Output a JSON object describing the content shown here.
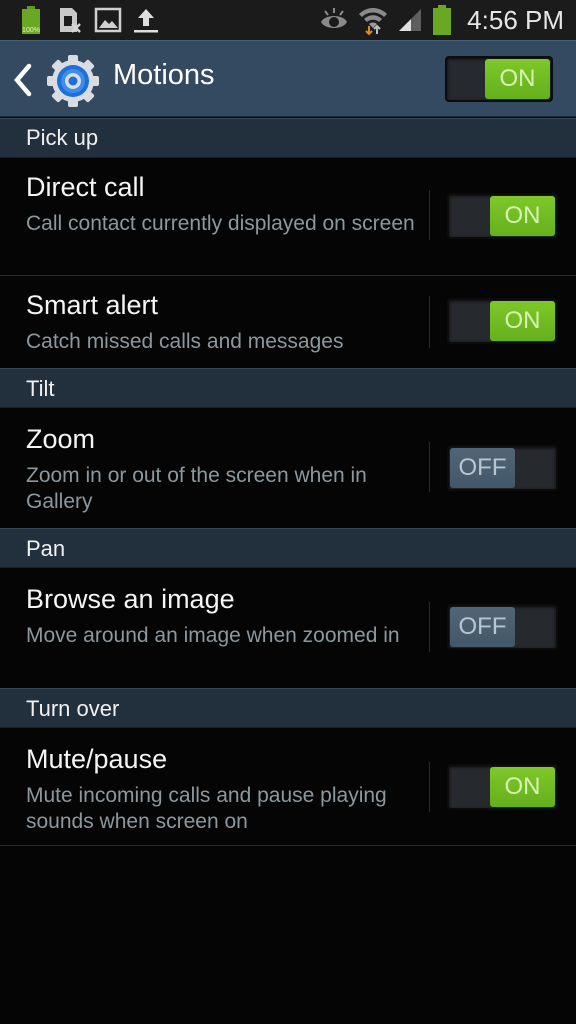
{
  "status_bar": {
    "battery_label": "100%",
    "time": "4:56 PM",
    "left_icons": [
      "battery-full-icon",
      "sim-missing-icon",
      "gallery-image-icon",
      "upload-icon"
    ],
    "right_icons": [
      "smart-stay-eye-icon",
      "wifi-data-icon",
      "cellular-signal-icon",
      "battery-icon"
    ]
  },
  "action_bar": {
    "title": "Motions",
    "master_switch": {
      "state": "on",
      "label": "ON"
    }
  },
  "sections": [
    {
      "header": "Pick up",
      "items": [
        {
          "title": "Direct call",
          "subtitle": "Call contact currently displayed on screen",
          "state": "on",
          "label": "ON"
        },
        {
          "title": "Smart alert",
          "subtitle": "Catch missed calls and messages",
          "state": "on",
          "label": "ON"
        }
      ]
    },
    {
      "header": "Tilt",
      "items": [
        {
          "title": "Zoom",
          "subtitle": "Zoom in or out of the screen when in Gallery",
          "state": "off",
          "label": "OFF"
        }
      ]
    },
    {
      "header": "Pan",
      "items": [
        {
          "title": "Browse an image",
          "subtitle": "Move around an image when zoomed in",
          "state": "off",
          "label": "OFF"
        }
      ]
    },
    {
      "header": "Turn over",
      "items": [
        {
          "title": "Mute/pause",
          "subtitle": "Mute incoming calls and pause playing sounds when screen on",
          "state": "on",
          "label": "ON"
        }
      ]
    }
  ],
  "colors": {
    "action_bar": "#334a60",
    "section_header": "#22303d",
    "switch_on": "#6fbd22",
    "switch_off": "#4a5f70",
    "background": "#050505"
  }
}
